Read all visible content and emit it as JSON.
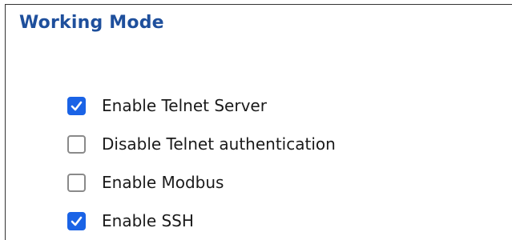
{
  "section": {
    "title": "Working Mode"
  },
  "options": [
    {
      "label": "Enable Telnet Server",
      "checked": true
    },
    {
      "label": "Disable Telnet authentication",
      "checked": false
    },
    {
      "label": "Enable Modbus",
      "checked": false
    },
    {
      "label": "Enable SSH",
      "checked": true
    }
  ],
  "colors": {
    "title": "#1e4f9c",
    "checkbox_checked": "#1a63e6",
    "checkbox_unchecked_border": "#8a8a8a"
  }
}
